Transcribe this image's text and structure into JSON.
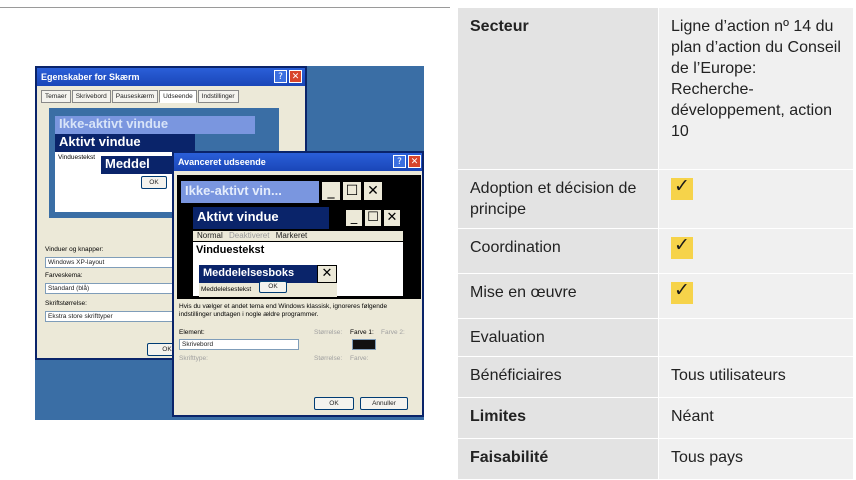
{
  "table": {
    "rows": [
      {
        "label": "Secteur",
        "bold": true,
        "value": "Ligne d’action nº 14 du plan d’action du Conseil de l’Europe: Recherche-développement, action 10",
        "check": false
      },
      {
        "label": "Adoption et décision de principe",
        "bold": false,
        "value": "",
        "check": true
      },
      {
        "label": "Coordination",
        "bold": false,
        "value": "",
        "check": true
      },
      {
        "label": "Mise en œuvre",
        "bold": false,
        "value": "",
        "check": true
      },
      {
        "label": "Evaluation",
        "bold": false,
        "value": "",
        "check": false
      },
      {
        "label": "Bénéficiaires",
        "bold": false,
        "value": "Tous utilisateurs",
        "check": false
      },
      {
        "label": "Limites",
        "bold": true,
        "value": "Néant",
        "check": false
      },
      {
        "label": "Faisabilité",
        "bold": true,
        "value": "Tous pays",
        "check": false
      }
    ],
    "check_glyph": "✓",
    "check_color": "#f6d34a"
  },
  "screenshot": {
    "back_window": {
      "title": "Egenskaber for Skærm",
      "tabs": [
        "Temaer",
        "Skrivebord",
        "Pauseskærm",
        "Udseende",
        "Indstillinger"
      ],
      "selected_tab": "Udseende",
      "inactive_label": "Ikke-aktivt vindue",
      "active_label": "Aktivt vindue",
      "msg_label": "Meddel",
      "window_text": "Vinduestekst",
      "ok": "OK",
      "windows_buttons_label": "Vinduer og knapper:",
      "windows_buttons_value": "Windows XP-layout",
      "color_scheme_label": "Farveskema:",
      "color_scheme_value": "Standard (blå)",
      "font_size_label": "Skriftstørrelse:",
      "font_size_value": "Ekstra store skrifttyper",
      "bottom_ok": "OK"
    },
    "front_window": {
      "title": "Avanceret udseende",
      "inactive": "Ikke-aktivt vin...",
      "active": "Aktivt vindue",
      "menu_normal": "Normal",
      "menu_disabled": "Deaktiveret",
      "menu_selected": "Markeret",
      "window_text": "Vinduestekst",
      "msgbox": "Meddelelsesboks",
      "msg_text": "Meddelelsestekst",
      "ok": "OK",
      "info": "Hvis du vælger et andet tema end Windows klassisk, ignoreres følgende indstillinger undtagen i nogle ældre programmer.",
      "element_label": "Element:",
      "element_value": "Skrivebord",
      "size_label": "Størrelse:",
      "color1_label": "Farve 1:",
      "color2_label": "Farve 2:",
      "font_label": "Skrifttype:",
      "size2_label": "Størrelse:",
      "color_label": "Farve:",
      "ok_btn": "OK",
      "cancel_btn": "Annuller"
    }
  }
}
